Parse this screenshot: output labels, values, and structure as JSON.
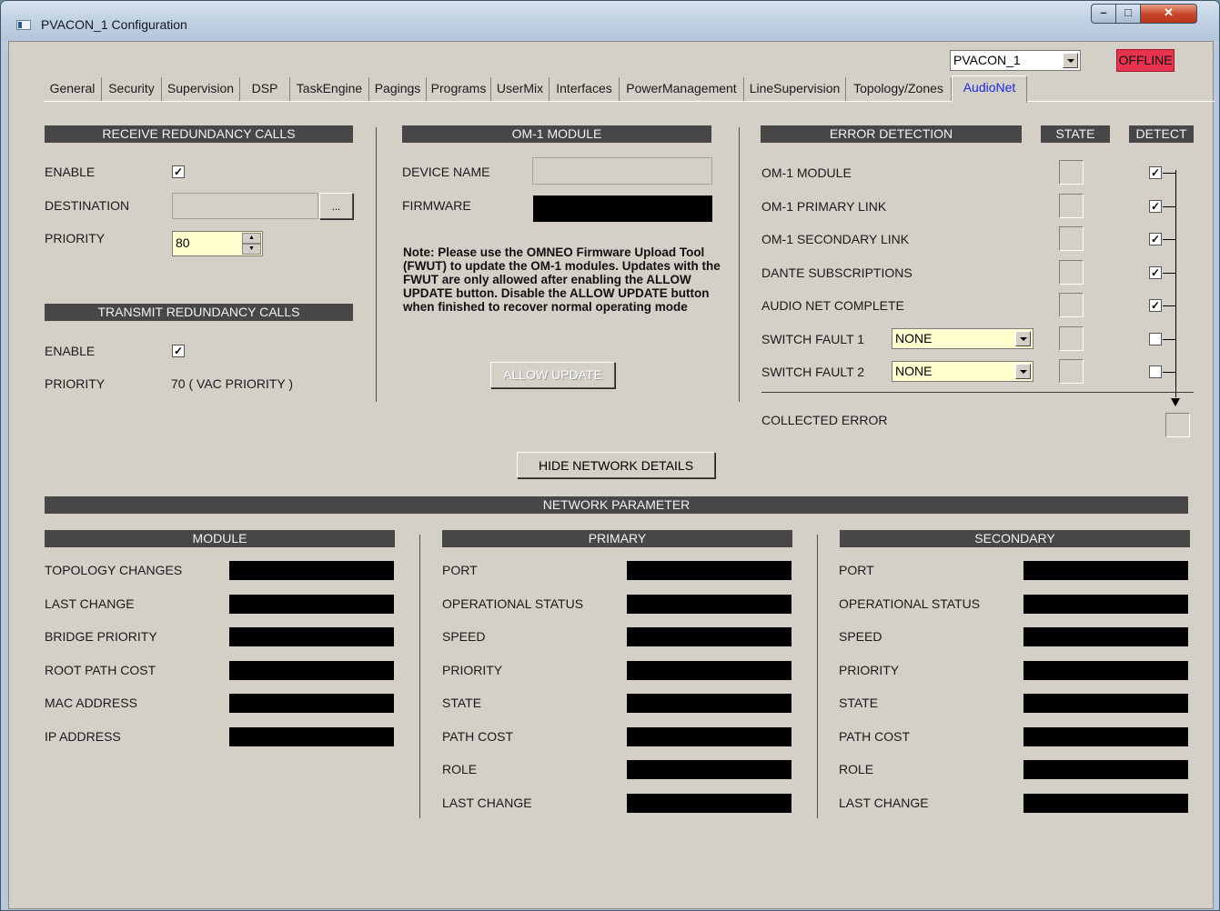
{
  "window": {
    "title": "PVACON_1 Configuration"
  },
  "device_select": {
    "value": "PVACON_1"
  },
  "status_badge": {
    "text": "OFFLINE",
    "color": "#e8334f"
  },
  "tabs": [
    {
      "label": "General"
    },
    {
      "label": "Security"
    },
    {
      "label": "Supervision"
    },
    {
      "label": "DSP"
    },
    {
      "label": "TaskEngine"
    },
    {
      "label": "Pagings"
    },
    {
      "label": "Programs"
    },
    {
      "label": "UserMix"
    },
    {
      "label": "Interfaces"
    },
    {
      "label": "PowerManagement"
    },
    {
      "label": "LineSupervision"
    },
    {
      "label": "Topology/Zones"
    },
    {
      "label": "AudioNet"
    }
  ],
  "active_tab": "AudioNet",
  "receive": {
    "header": "RECEIVE REDUNDANCY CALLS",
    "enable_label": "ENABLE",
    "enable_checked": true,
    "destination_label": "DESTINATION",
    "destination_value": "",
    "browse_label": "...",
    "priority_label": "PRIORITY",
    "priority_value": "80"
  },
  "transmit": {
    "header": "TRANSMIT REDUNDANCY CALLS",
    "enable_label": "ENABLE",
    "enable_checked": true,
    "priority_label": "PRIORITY",
    "priority_value": "70 ( VAC PRIORITY )"
  },
  "om1": {
    "header": "OM-1 MODULE",
    "device_name_label": "DEVICE NAME",
    "device_name_value": "",
    "firmware_label": "FIRMWARE",
    "note": "Note: Please use the OMNEO Firmware Upload Tool (FWUT) to update the OM-1 modules. Updates with the FWUT are only allowed after enabling the ALLOW UPDATE button. Disable the ALLOW UPDATE button when finished to recover normal operating mode",
    "allow_update_label": "ALLOW UPDATE"
  },
  "errors": {
    "header": "ERROR DETECTION",
    "state_header": "STATE",
    "detect_header": "DETECT",
    "rows": [
      {
        "label": "OM-1 MODULE",
        "detect": true
      },
      {
        "label": "OM-1 PRIMARY LINK",
        "detect": true
      },
      {
        "label": "OM-1 SECONDARY LINK",
        "detect": true
      },
      {
        "label": "DANTE SUBSCRIPTIONS",
        "detect": true
      },
      {
        "label": "AUDIO NET COMPLETE",
        "detect": true
      },
      {
        "label": "SWITCH FAULT 1",
        "detect": false,
        "select": "NONE"
      },
      {
        "label": "SWITCH FAULT 2",
        "detect": false,
        "select": "NONE"
      }
    ],
    "collected_label": "COLLECTED ERROR"
  },
  "hide_details_label": "HIDE NETWORK DETAILS",
  "network": {
    "header": "NETWORK PARAMETER",
    "module": {
      "header": "MODULE",
      "rows": [
        "TOPOLOGY CHANGES",
        "LAST CHANGE",
        "BRIDGE PRIORITY",
        "ROOT PATH COST",
        "MAC ADDRESS",
        "IP ADDRESS"
      ]
    },
    "primary": {
      "header": "PRIMARY",
      "rows": [
        "PORT",
        "OPERATIONAL STATUS",
        "SPEED",
        "PRIORITY",
        "STATE",
        "PATH COST",
        "ROLE",
        "LAST CHANGE"
      ]
    },
    "secondary": {
      "header": "SECONDARY",
      "rows": [
        "PORT",
        "OPERATIONAL STATUS",
        "SPEED",
        "PRIORITY",
        "STATE",
        "PATH COST",
        "ROLE",
        "LAST CHANGE"
      ]
    }
  },
  "icons": [
    "app-icon",
    "minimize-icon",
    "maximize-icon",
    "close-icon",
    "dropdown-arrow-icon",
    "spin-up-icon",
    "spin-down-icon",
    "checkmark-icon",
    "arrow-down-icon"
  ]
}
